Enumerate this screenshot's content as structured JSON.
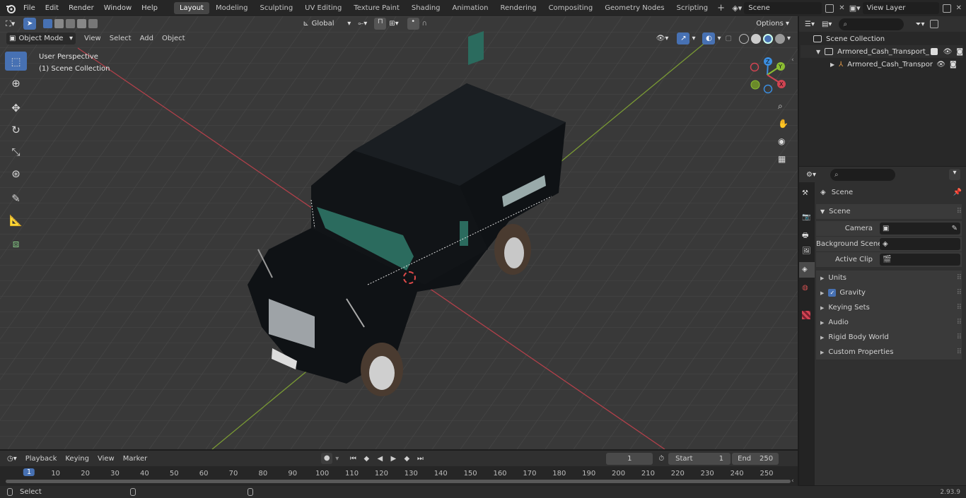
{
  "menu": [
    "File",
    "Edit",
    "Render",
    "Window",
    "Help"
  ],
  "workspaces": [
    "Layout",
    "Modeling",
    "Sculpting",
    "UV Editing",
    "Texture Paint",
    "Shading",
    "Animation",
    "Rendering",
    "Compositing",
    "Geometry Nodes",
    "Scripting"
  ],
  "scene_field": "Scene",
  "view_layer_field": "View Layer",
  "viewport": {
    "mode": "Object Mode",
    "menus": [
      "View",
      "Select",
      "Add",
      "Object"
    ],
    "transform_orientation": "Global",
    "options_label": "Options",
    "overlay_title": "User Perspective",
    "overlay_collection": "(1) Scene Collection"
  },
  "gizmo_axes": {
    "z": "Z",
    "y": "Y",
    "x": "X"
  },
  "outliner": {
    "root": "Scene Collection",
    "collection": "Armored_Cash_Transport_Ca",
    "object": "Armored_Cash_Transpor"
  },
  "properties": {
    "header": "Scene",
    "panel": "Scene",
    "camera_label": "Camera",
    "background_label": "Background Scene",
    "clip_label": "Active Clip",
    "sections": [
      "Units",
      "Gravity",
      "Keying Sets",
      "Audio",
      "Rigid Body World",
      "Custom Properties"
    ]
  },
  "timeline": {
    "menus": [
      "Playback",
      "Keying",
      "View",
      "Marker"
    ],
    "current_frame": "1",
    "start_label": "Start",
    "start_value": "1",
    "end_label": "End",
    "end_value": "250",
    "ticks": [
      "1",
      "10",
      "20",
      "30",
      "40",
      "50",
      "60",
      "70",
      "80",
      "90",
      "100",
      "110",
      "120",
      "130",
      "140",
      "150",
      "160",
      "170",
      "180",
      "190",
      "200",
      "210",
      "220",
      "230",
      "240",
      "250"
    ]
  },
  "status": {
    "left": "Select",
    "version": "2.93.9"
  },
  "colors": {
    "accent": "#4771b3",
    "x_axis": "#d04452",
    "y_axis": "#8bbd32",
    "z_axis": "#3b8ee0"
  }
}
